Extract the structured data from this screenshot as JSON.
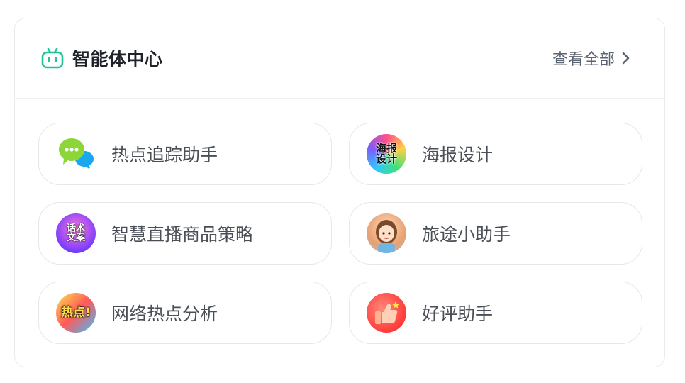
{
  "header": {
    "title": "智能体中心",
    "view_all_label": "查看全部",
    "icon": "robot-tv-icon",
    "accent_color": "#22c39a"
  },
  "agents": [
    {
      "label": "热点追踪助手",
      "icon": "chat-bubbles-icon"
    },
    {
      "label": "海报设计",
      "icon": "poster-design-avatar",
      "avatar_text": "海报设计"
    },
    {
      "label": "智慧直播商品策略",
      "icon": "live-script-avatar",
      "avatar_text": "话术文案"
    },
    {
      "label": "旅途小助手",
      "icon": "travel-girl-avatar"
    },
    {
      "label": "网络热点分析",
      "icon": "hot-topic-avatar",
      "avatar_text": "热点!"
    },
    {
      "label": "好评助手",
      "icon": "thumbs-up-avatar"
    }
  ]
}
